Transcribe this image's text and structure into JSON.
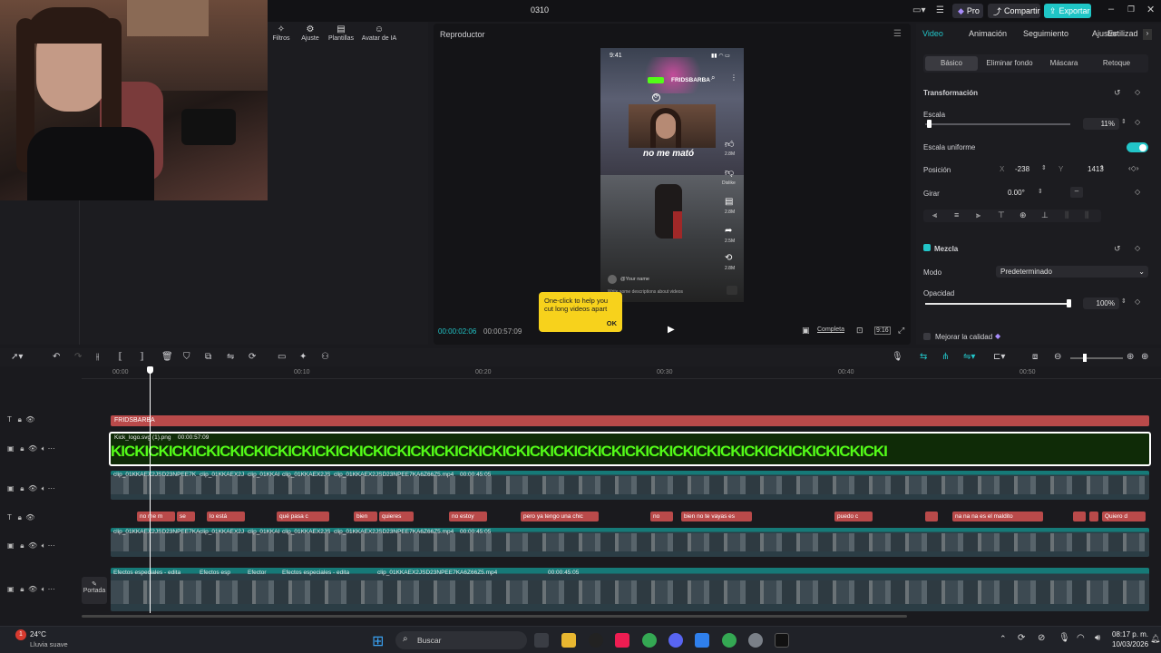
{
  "window": {
    "title": "0310"
  },
  "header": {
    "pro_label": "Pro",
    "share_label": "Compartir",
    "export_label": "Exportar"
  },
  "left_toolbar": {
    "items": [
      "Filtros",
      "Ajuste",
      "Plantillas",
      "Avatar de IA"
    ]
  },
  "player": {
    "title": "Reproductor",
    "current_time": "00:00:02:06",
    "total_time": "00:00:57:09",
    "complete_label": "Completa",
    "ratio_label": "9:16",
    "phone": {
      "status_time": "9:41",
      "channel": "FRIDSBARBA",
      "caption": "no me mató",
      "likes": "2.8M",
      "dislike": "Dislike",
      "comments": "2.8M",
      "shares": "2.5M",
      "remix": "2.8M",
      "username": "@Your name",
      "description": "Write some descriptions about videos"
    }
  },
  "tooltip": {
    "text": "One-click to help you cut long videos apart",
    "ok": "OK"
  },
  "right_panel": {
    "tabs": [
      "Video",
      "Animación",
      "Seguimiento",
      "Ajustar",
      "Estilizad"
    ],
    "subtabs": [
      "Básico",
      "Eliminar fondo",
      "Máscara",
      "Retoque"
    ],
    "transform_title": "Transformación",
    "scale_label": "Escala",
    "scale_value": "11%",
    "uniform_label": "Escala uniforme",
    "position_label": "Posición",
    "pos_x_label": "X",
    "pos_x": "-238",
    "pos_y_label": "Y",
    "pos_y": "1413",
    "rotate_label": "Girar",
    "rotate_value": "0.00°",
    "blend_title": "Mezcla",
    "mode_label": "Modo",
    "mode_value": "Predeterminado",
    "opacity_label": "Opacidad",
    "opacity_value": "100%",
    "quality_label": "Mejorar la calidad"
  },
  "timeline": {
    "ticks": [
      "00:00",
      "00:10",
      "00:20",
      "00:30",
      "00:40",
      "00:50"
    ],
    "text_track_label": "FRIDSBARBA",
    "sticker_label": "Kick_logo.svg (1).png",
    "sticker_duration": "00:00:57:09",
    "sticker_text": "KICKICKICKICKICKICKICKICKICKICKICKICKICKICKICKICKICKICKICKICKICKICKICKICKICKICKICKICKICKICKICKICKI",
    "clips_row1": [
      "clip_01KKAEX2JSD23NPEE7K",
      "clip_01KKAEX2J",
      "clip_01KKAI",
      "clip_01KKAEX2JS",
      "clip_01KKAEX2JSD23NPEE7KA6Z66Z5.mp4",
      "00:00:45:05"
    ],
    "captions": [
      "no me m",
      "se",
      "lo está",
      "qué pasa c",
      "bien",
      "quieres",
      "no estoy",
      "pero ya tengo una chic",
      "no",
      "bien no te vayas es",
      "puedo c",
      "na na na es el maldito",
      "Quiero d"
    ],
    "clips_row2": [
      "clip_01KKAEX2JSD23NPEE7KA",
      "clip_01KKAEX2J",
      "clip_01KKAI",
      "clip_01KKAEX2JS",
      "clip_01KKAEX2JSD23NPEE7KA6Z66Z5.mp4",
      "00:00:45:05"
    ],
    "clips_row3": [
      "Efectos especiales - edita",
      "Efectos esp",
      "Efector",
      "Efectos especiales - edita",
      "clip_01KKAEX2JSD23NPEE7KA6Z66Z5.mp4",
      "00:00:45:05"
    ],
    "cover_label": "Portada"
  },
  "taskbar": {
    "weather_temp": "24°C",
    "weather_desc": "Lluvia suave",
    "search_placeholder": "Buscar",
    "time": "08:17 p. m.",
    "date": "10/03/2026",
    "badge": "1"
  },
  "colors": {
    "accent": "#22c5c8",
    "tooltip": "#f7d21c",
    "caption_red": "#b94a4a",
    "kick_green": "#53fc18"
  }
}
